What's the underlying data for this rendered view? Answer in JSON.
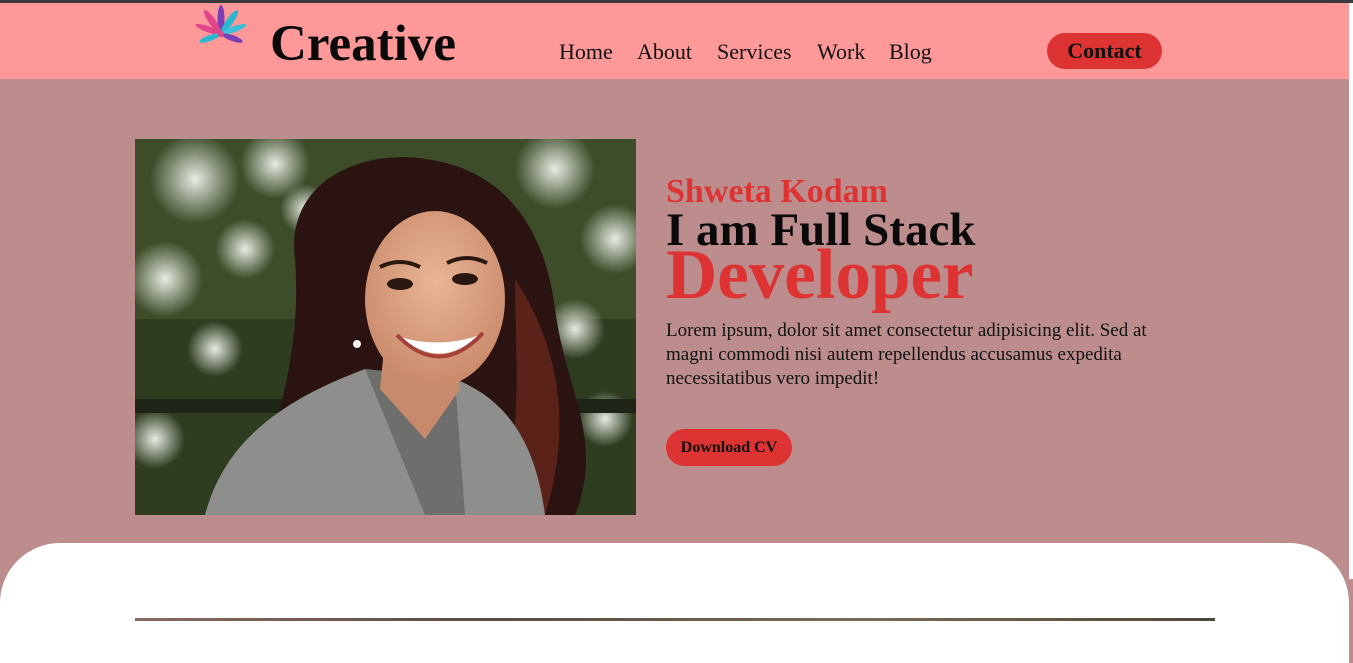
{
  "header": {
    "brand": "Creative",
    "logo_icon": "flower-logo-icon",
    "nav": [
      "Home",
      "About",
      "Services",
      "Work",
      "Blog"
    ],
    "contact_label": "Contact"
  },
  "hero": {
    "name": "Shweta Kodam",
    "headline": "I am Full Stack",
    "role": "Developer",
    "description": "Lorem ipsum, dolor sit amet consectetur adipisicing elit. Sed at magni commodi nisi autem repellendus accusamus expedita necessitatibus vero impedit!",
    "cv_label": "Download CV",
    "photo": "portrait-photo"
  },
  "colors": {
    "header_bg": "#ff9999",
    "page_bg": "#bd8c8c",
    "accent": "#dd3333"
  }
}
